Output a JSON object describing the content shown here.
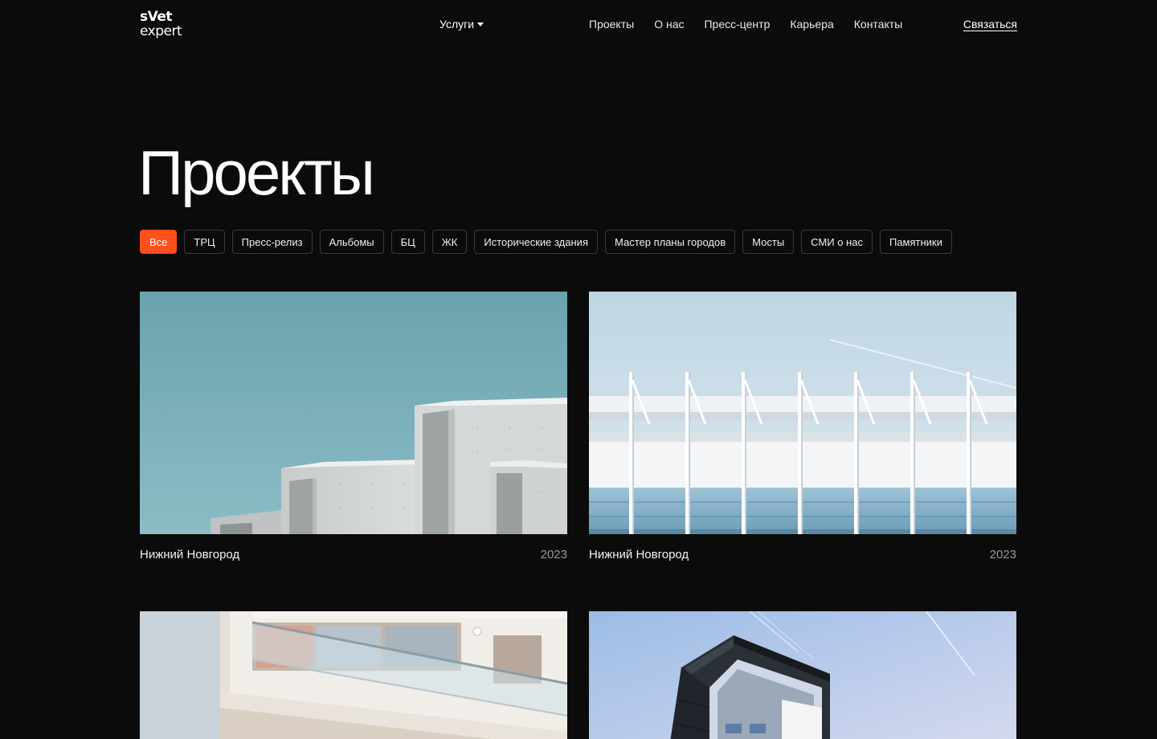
{
  "header": {
    "logo_top": "sVet",
    "logo_bottom": "expert",
    "services_label": "Услуги",
    "nav": [
      "Проекты",
      "О нас",
      "Пресс-центр",
      "Карьера",
      "Контакты"
    ],
    "contact_label": "Связаться"
  },
  "page_title": "Проекты",
  "filters": [
    "Все",
    "ТРЦ",
    "Пресс-релиз",
    "Альбомы",
    "БЦ",
    "ЖК",
    "Исторические здания",
    "Мастер планы городов",
    "Мосты",
    "СМИ о нас",
    "Памятники"
  ],
  "active_filter": "Все",
  "projects": [
    {
      "city": "Нижний Новгород",
      "year": "2023"
    },
    {
      "city": "Нижний Новгород",
      "year": "2023"
    }
  ],
  "colors": {
    "background": "#0b0b0b",
    "accent": "#ff4f1a"
  }
}
